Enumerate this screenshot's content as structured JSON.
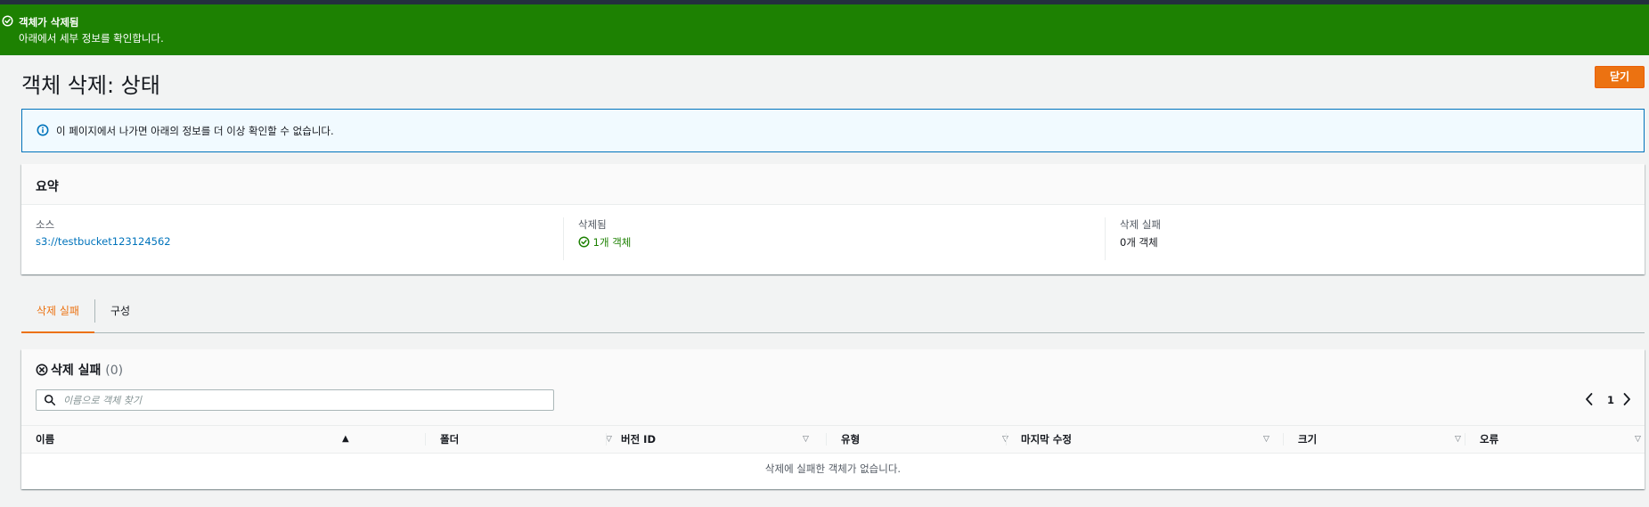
{
  "flash": {
    "title": "객체가 삭제됨",
    "message": "아래에서 세부 정보를 확인합니다.",
    "icon": "check-circle-icon",
    "color": "#1d8102"
  },
  "page": {
    "title": "객체 삭제: 상태",
    "close_label": "닫기"
  },
  "info": {
    "icon": "info-icon",
    "text": "이 페이지에서 나가면 아래의 정보를 더 이상 확인할 수 없습니다."
  },
  "summary": {
    "title": "요약",
    "source_label": "소스",
    "source_value": "s3://testbucket123124562",
    "deleted_label": "삭제됨",
    "deleted_value": "1개 객체",
    "failed_label": "삭제 실패",
    "failed_value": "0개 객체"
  },
  "tabs": [
    {
      "label": "삭제 실패",
      "active": true
    },
    {
      "label": "구성",
      "active": false
    }
  ],
  "failures": {
    "title": "삭제 실패",
    "count": "(0)",
    "search_placeholder": "이름으로 객체 찾기",
    "page": "1",
    "columns": [
      "이름",
      "폴더",
      "버전 ID",
      "유형",
      "마지막 수정",
      "크기",
      "오류"
    ],
    "empty_message": "삭제에 실패한 객체가 없습니다."
  },
  "colors": {
    "accent": "#ec7211",
    "link": "#0073bb",
    "success": "#1d8102"
  }
}
